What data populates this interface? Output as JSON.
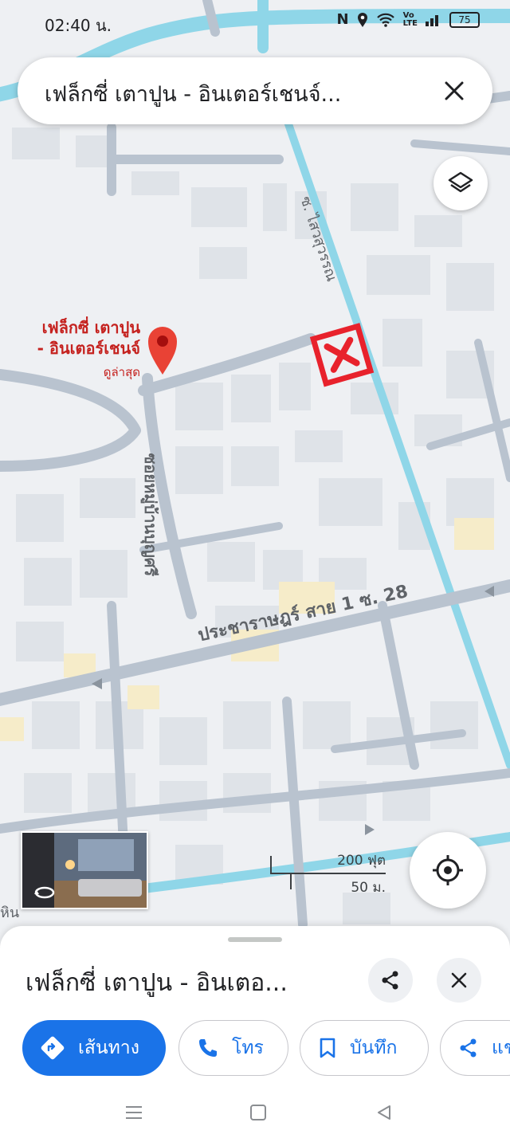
{
  "status": {
    "time": "02:40 น.",
    "battery": "75"
  },
  "search": {
    "query": "เฟล็กซี่ เตาปูน - อินเตอร์เชนจ์..."
  },
  "map": {
    "place_name_line1": "เฟล็กซี่ เตาปูน",
    "place_name_line2": "- อินเตอร์เชนจ์",
    "place_sub": "ดูล่าสุด",
    "street_main": "ประชาราษฎร์ สาย 1 ซ. 28",
    "street_vertical": "ซอยหมู่บ้านบุญศรี",
    "street_canal": "ซ. ไสวสุวรรณ",
    "edge_label": "หิน",
    "scale_top": "200 ฟุต",
    "scale_bottom": "50 ม.",
    "marker_color": "#e8222c",
    "pin_color": "#e94235"
  },
  "sheet": {
    "title": "เฟล็กซี่ เตาปูน - อินเตอ...",
    "directions_label": "เส้นทาง",
    "call_label": "โทร",
    "save_label": "บันทึก",
    "share_label": "แช"
  },
  "colors": {
    "accent": "#1a73e8",
    "water": "#8fd6e8",
    "road": "#b9c3cf",
    "building": "#dfe3e8"
  }
}
